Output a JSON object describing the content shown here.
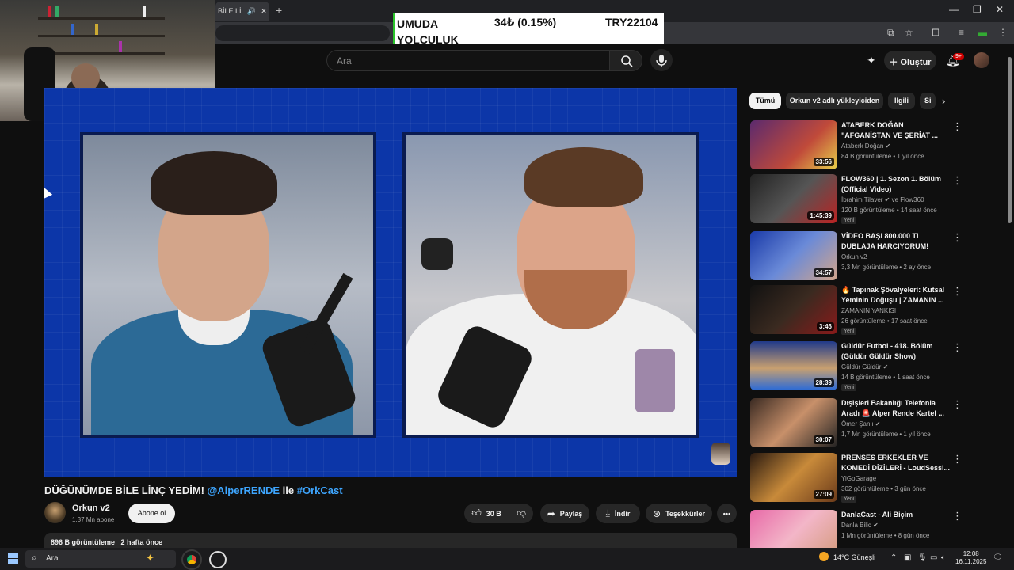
{
  "browser": {
    "tab_title": "BİLE Lİ",
    "tab_audio_icon": "speaker-icon",
    "new_tab": "+",
    "window_controls": [
      "—",
      "❐",
      "✕"
    ]
  },
  "stock_ticker": {
    "name": "UMUDA YOLCULUK",
    "change": "34₺ (0.15%)",
    "price": "TRY22104",
    "accent": "#2bc52b"
  },
  "youtube_header": {
    "search_placeholder": "Ara",
    "create_label": "Oluştur",
    "notification_count": "9+"
  },
  "video": {
    "background_color": "#0c36a8",
    "title_main": "DÜĞÜNÜMDE BİLE LİNÇ YEDİM!",
    "title_mention": "@AlperRENDE",
    "title_connector": "ile",
    "title_hashtag": "#OrkCast"
  },
  "channel": {
    "name": "Orkun v2",
    "subscribers": "1,37 Mn abone",
    "subscribe_label": "Abone ol"
  },
  "actions": {
    "likes": "30 B",
    "share": "Paylaş",
    "download": "İndir",
    "thanks": "Teşekkürler",
    "more": "•••"
  },
  "description": {
    "views": "896 B görüntüleme",
    "age": "2 hafta önce"
  },
  "chips": [
    {
      "label": "Tümü",
      "active": true
    },
    {
      "label": "Orkun v2 adlı yükleyiciden",
      "active": false
    },
    {
      "label": "İlgili",
      "active": false
    },
    {
      "label": "Si",
      "active": false
    }
  ],
  "related": [
    {
      "title": "ATABERK DOĞAN \"AFGANİSTAN VE ŞERİAT ...",
      "channel": "Ataberk Doğan ✔",
      "meta": "84 B görüntüleme • 1 yıl önce",
      "duration": "33:56",
      "badge": ""
    },
    {
      "title": "FLOW360 | 1. Sezon 1. Bölüm (Official Video)",
      "channel": "İbrahim Tilaver ✔ ve Flow360",
      "meta": "120 B görüntüleme • 14 saat önce",
      "duration": "1:45:39",
      "badge": "Yeni"
    },
    {
      "title": "VİDEO BAŞI 800.000 TL DUBLAJA HARCIYORUM! Ruhi...",
      "channel": "Orkun v2",
      "meta": "3,3 Mn görüntüleme • 2 ay önce",
      "duration": "34:57",
      "badge": ""
    },
    {
      "title": "🔥 Tapınak Şövalyeleri: Kutsal Yeminin Doğuşu | ZAMANIN ...",
      "channel": "ZAMANIN YANKISI",
      "meta": "26 görüntüleme • 17 saat önce",
      "duration": "3:46",
      "badge": "Yeni"
    },
    {
      "title": "Güldür Futbol - 418. Bölüm (Güldür Güldür Show)",
      "channel": "Güldür Güldür ✔",
      "meta": "14 B görüntüleme • 1 saat önce",
      "duration": "28:39",
      "badge": "Yeni"
    },
    {
      "title": "Dışişleri Bakanlığı Telefonla Aradı 🚨 Alper Rende Kartel ...",
      "channel": "Ömer Şanlı ✔",
      "meta": "1,7 Mn görüntüleme • 1 yıl önce",
      "duration": "30:07",
      "badge": ""
    },
    {
      "title": "PRENSES ERKEKLER VE KOMEDİ DİZİLERİ - LoudSessi...",
      "channel": "YiGoGarage",
      "meta": "302 görüntüleme • 3 gün önce",
      "duration": "27:09",
      "badge": "Yeni"
    },
    {
      "title": "DanlaCast - Ali Biçim",
      "channel": "Danla Bilic ✔",
      "meta": "1 Mn görüntüleme • 8 gün önce",
      "duration": "",
      "badge": ""
    }
  ],
  "taskbar": {
    "search_placeholder": "Ara",
    "weather": "14°C Güneşli",
    "time": "12:08",
    "date": "16.11.2025"
  }
}
